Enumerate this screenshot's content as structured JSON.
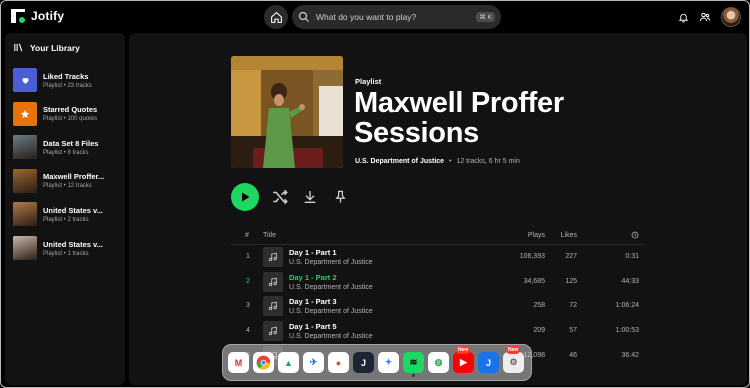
{
  "app": {
    "name": "Jotify"
  },
  "search": {
    "placeholder": "What do you want to play?",
    "shortcut": "⌘ K"
  },
  "library": {
    "title": "Your Library",
    "items": [
      {
        "title": "Liked Tracks",
        "subtitle": "Playlist • 23 tracks",
        "icon": "heart-icon",
        "color": "#4b5ed6"
      },
      {
        "title": "Starred Quotes",
        "subtitle": "Playlist • 100 quotes",
        "icon": "star-icon",
        "color": "#e8720c"
      },
      {
        "title": "Data Set 8 Files",
        "subtitle": "Playlist • 8 tracks",
        "icon": "photo-thumbnail",
        "color": "#6a7d8a"
      },
      {
        "title": "Maxwell Proffer...",
        "subtitle": "Playlist • 12 tracks",
        "icon": "photo-thumbnail",
        "color": "#9a6a30"
      },
      {
        "title": "United States v...",
        "subtitle": "Playlist • 2 tracks",
        "icon": "photo-thumbnail",
        "color": "#b07a4a"
      },
      {
        "title": "United States v...",
        "subtitle": "Playlist • 1 tracks",
        "icon": "photo-thumbnail",
        "color": "#c9b9a8"
      }
    ]
  },
  "playlist": {
    "type": "Playlist",
    "title_line1": "Maxwell Proffer",
    "title_line2": "Sessions",
    "owner": "U.S. Department of Justice",
    "summary": "12 tracks, 6 hr 5 min",
    "separator": "•"
  },
  "table": {
    "headers": {
      "num": "#",
      "title": "Title",
      "plays": "Plays",
      "likes": "Likes"
    },
    "rows": [
      {
        "num": "1",
        "title": "Day 1 - Part 1",
        "artist": "U.S. Department of Justice",
        "plays": "106,393",
        "likes": "227",
        "duration": "0:31",
        "active": false
      },
      {
        "num": "2",
        "title": "Day 1 - Part 2",
        "artist": "U.S. Department of Justice",
        "plays": "34,685",
        "likes": "125",
        "duration": "44:33",
        "active": true
      },
      {
        "num": "3",
        "title": "Day 1 - Part 3",
        "artist": "U.S. Department of Justice",
        "plays": "258",
        "likes": "72",
        "duration": "1:06:24",
        "active": false
      },
      {
        "num": "4",
        "title": "Day 1 - Part 5",
        "artist": "U.S. Department of Justice",
        "plays": "209",
        "likes": "57",
        "duration": "1:00:53",
        "active": false
      },
      {
        "num": "5",
        "title": "",
        "artist": "",
        "plays": "12,098",
        "likes": "46",
        "duration": "36:42",
        "active": false
      }
    ]
  },
  "dock": {
    "badge_text": "New",
    "apps": [
      {
        "name": "gmail-app",
        "glyph": "M",
        "bg": "#ffffff",
        "fg": "#d93025"
      },
      {
        "name": "chrome-app",
        "glyph": "",
        "bg": "#ffffff",
        "fg": "#000"
      },
      {
        "name": "drive-app",
        "glyph": "▲",
        "bg": "#ffffff",
        "fg": "#1fa463"
      },
      {
        "name": "flights-app",
        "glyph": "✈",
        "bg": "#ffffff",
        "fg": "#1a73e8"
      },
      {
        "name": "color-app",
        "glyph": "●",
        "bg": "#ffffff",
        "fg": "#e8453c"
      },
      {
        "name": "j-app",
        "glyph": "J",
        "bg": "#1c2533",
        "fg": "#ffffff"
      },
      {
        "name": "gemini-app",
        "glyph": "✦",
        "bg": "#ffffff",
        "fg": "#4285f4"
      },
      {
        "name": "jotify-app",
        "glyph": "≋",
        "bg": "#1ed760",
        "fg": "#000"
      },
      {
        "name": "chat-app",
        "glyph": "◍",
        "bg": "#ffffff",
        "fg": "#34a853"
      },
      {
        "name": "video-app",
        "glyph": "▶",
        "bg": "#ff0000",
        "fg": "#ffffff"
      },
      {
        "name": "j-blue-app",
        "glyph": "J",
        "bg": "#1a73e8",
        "fg": "#ffffff"
      },
      {
        "name": "gear-app",
        "glyph": "⚙",
        "bg": "#eeeeee",
        "fg": "#666"
      }
    ]
  }
}
